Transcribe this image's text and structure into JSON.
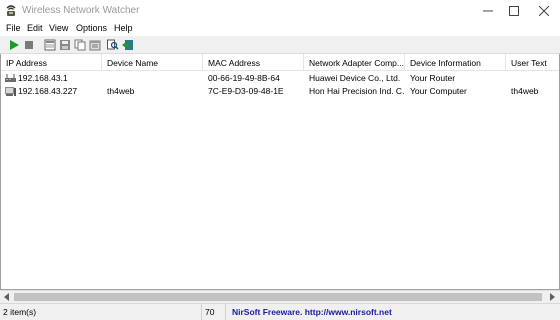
{
  "window": {
    "title": "Wireless Network Watcher"
  },
  "menu": {
    "items": [
      "File",
      "Edit",
      "View",
      "Options",
      "Help"
    ]
  },
  "toolbar": {
    "buttons": [
      {
        "icon": "play-icon",
        "label": "Start Scanning"
      },
      {
        "icon": "stop-icon",
        "label": "Stop Scanning"
      },
      {
        "icon": "html-report-icon",
        "label": "HTML Report"
      },
      {
        "icon": "save-icon",
        "label": "Save Selected Items"
      },
      {
        "icon": "copy-icon",
        "label": "Copy Selected Items"
      },
      {
        "icon": "properties-icon",
        "label": "Properties"
      },
      {
        "icon": "find-icon",
        "label": "Find"
      },
      {
        "icon": "exit-icon",
        "label": "Exit"
      }
    ]
  },
  "table": {
    "columns": [
      "IP Address",
      "Device Name",
      "MAC Address",
      "Network Adapter Comp...",
      "Device Information",
      "User Text"
    ],
    "rows": [
      {
        "icon": "router-icon",
        "ip": "192.168.43.1",
        "device_name": "",
        "mac": "00-66-19-49-8B-64",
        "adapter": "Huawei Device Co., Ltd.",
        "info": "Your Router",
        "user_text": ""
      },
      {
        "icon": "computer-icon",
        "ip": "192.168.43.227",
        "device_name": "th4web",
        "mac": "7C-E9-D3-09-48-1E",
        "adapter": "Hon Hai Precision Ind. C...",
        "info": "Your Computer",
        "user_text": "th4web"
      }
    ]
  },
  "status": {
    "items_count": "2 item(s)",
    "number": "70",
    "freeware_text": "NirSoft Freeware.  http://www.nirsoft.net"
  },
  "colors": {
    "toolbar_bg": "#f0f0f0",
    "link_blue": "#1a1aa6",
    "play_green": "#1e9a2a"
  }
}
